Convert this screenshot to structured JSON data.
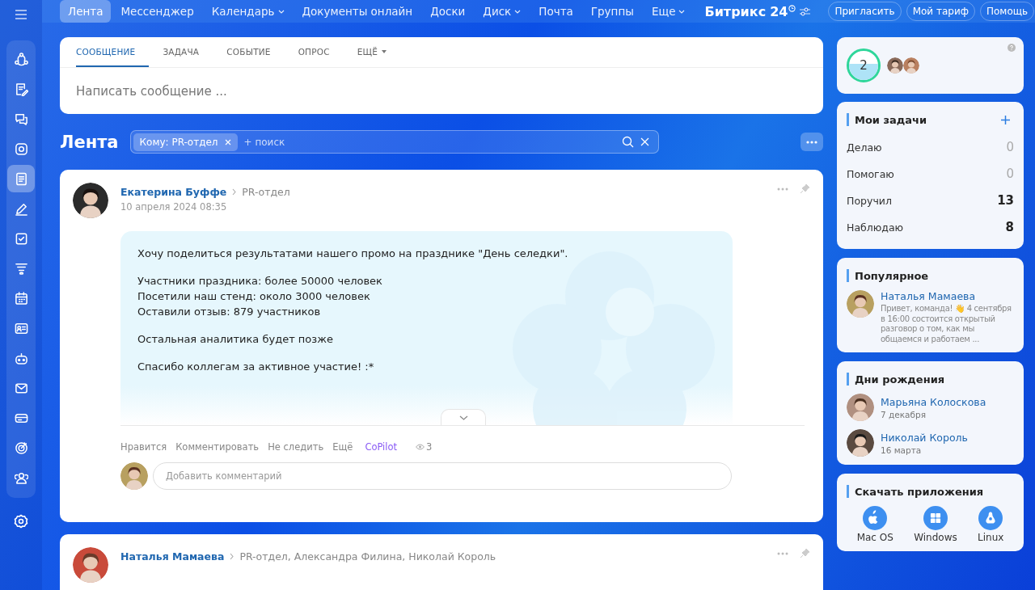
{
  "topbar": {
    "menu_items": [
      {
        "label": "Лента",
        "selected": true,
        "dropdown": false
      },
      {
        "label": "Мессенджер",
        "selected": false,
        "dropdown": false
      },
      {
        "label": "Календарь",
        "selected": false,
        "dropdown": true
      },
      {
        "label": "Документы онлайн",
        "selected": false,
        "dropdown": false
      },
      {
        "label": "Доски",
        "selected": false,
        "dropdown": false
      },
      {
        "label": "Диск",
        "selected": false,
        "dropdown": true
      },
      {
        "label": "Почта",
        "selected": false,
        "dropdown": false
      },
      {
        "label": "Группы",
        "selected": false,
        "dropdown": false
      },
      {
        "label": "Еще",
        "selected": false,
        "dropdown": true
      }
    ],
    "logo": {
      "name": "Битрикс",
      "number": "24"
    },
    "buttons": [
      "Пригласить",
      "Мой тариф",
      "Помощь"
    ]
  },
  "sidebar": {
    "items": [
      {
        "selected": false
      },
      {
        "selected": false
      },
      {
        "selected": false
      },
      {
        "selected": false
      },
      {
        "selected": true
      },
      {
        "selected": false
      },
      {
        "selected": false
      },
      {
        "selected": false
      },
      {
        "selected": false
      },
      {
        "selected": false
      },
      {
        "selected": false
      },
      {
        "selected": false
      },
      {
        "selected": false
      },
      {
        "selected": false
      },
      {
        "selected": false
      }
    ]
  },
  "composer": {
    "tabs": [
      {
        "label": "СООБЩЕНИЕ",
        "selected": true,
        "dropdown": false
      },
      {
        "label": "ЗАДАЧА",
        "selected": false,
        "dropdown": false
      },
      {
        "label": "СОБЫТИЕ",
        "selected": false,
        "dropdown": false
      },
      {
        "label": "ОПРОС",
        "selected": false,
        "dropdown": false
      },
      {
        "label": "ЕЩЁ",
        "selected": false,
        "dropdown": true
      }
    ],
    "placeholder": "Написать сообщение ..."
  },
  "feed": {
    "title": "Лента",
    "filter_tag": "Кому: PR-отдел",
    "search_placeholder": "+ поиск"
  },
  "posts": [
    {
      "author": "Екатерина Буффе",
      "recipients": "PR-отдел",
      "date": "10 апреля 2024 08:35",
      "paragraphs": [
        [
          "Хочу поделиться результатами нашего промо на празднике \"День селедки\"."
        ],
        [
          "Участники праздника: более 50000 человек",
          "Посетили наш стенд: около 3000 человек",
          "Оставили отзыв: 879 участников"
        ],
        [
          "Остальная аналитика будет позже"
        ],
        [
          "Спасибо коллегам за активное участие! :*"
        ]
      ],
      "actions": [
        "Нравится",
        "Комментировать",
        "Не следить",
        "Ещё"
      ],
      "copilot": "CoPilot",
      "views": "3",
      "comment_placeholder": "Добавить комментарий"
    },
    {
      "author": "Наталья Мамаева",
      "recipients": "PR-отдел, Александра Филина, Николай Король"
    }
  ],
  "online": {
    "count": "2"
  },
  "tasks": {
    "title": "Мои задачи",
    "rows": [
      {
        "label": "Делаю",
        "value": "0",
        "active": false
      },
      {
        "label": "Помогаю",
        "value": "0",
        "active": false
      },
      {
        "label": "Поручил",
        "value": "13",
        "active": true
      },
      {
        "label": "Наблюдаю",
        "value": "8",
        "active": true
      }
    ]
  },
  "popular": {
    "title": "Популярное",
    "name": "Наталья Мамаева",
    "text": "Привет, команда! 👋 4 сентября в 16:00 состоится открытый разговор о том, как мы общаемся и работаем ..."
  },
  "birthdays": {
    "title": "Дни рождения",
    "people": [
      {
        "name": "Марьяна Колоскова",
        "date": "7 декабря"
      },
      {
        "name": "Николай Король",
        "date": "16 марта"
      }
    ]
  },
  "apps": {
    "title": "Скачать приложения",
    "items": [
      {
        "label": "Mac OS"
      },
      {
        "label": "Windows"
      },
      {
        "label": "Linux"
      }
    ]
  }
}
